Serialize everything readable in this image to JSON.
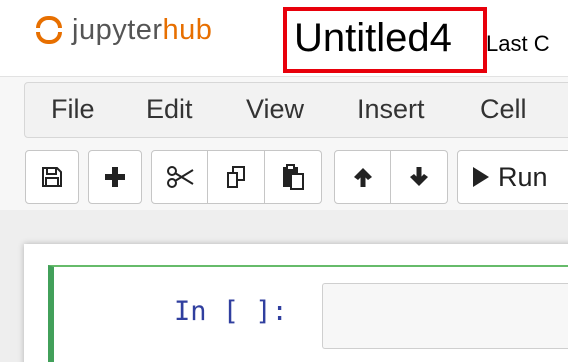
{
  "header": {
    "logo_text_part1": "jupyter",
    "logo_text_part2": "hub",
    "notebook_title": "Untitled4",
    "last_saved_fragment": "Last C"
  },
  "menu": {
    "items": [
      "File",
      "Edit",
      "View",
      "Insert",
      "Cell"
    ]
  },
  "toolbar": {
    "run_label": "Run",
    "icons": [
      "save-icon",
      "plus-icon",
      "cut-icon",
      "copy-icon",
      "paste-icon",
      "arrow-up-icon",
      "arrow-down-icon",
      "run-icon"
    ]
  },
  "cell": {
    "prompt": "In [ ]:",
    "input_value": ""
  },
  "colors": {
    "brand_orange": "#e76f00",
    "highlight_red": "#e8000b",
    "cell_edit_green": "#42a05a",
    "prompt_blue": "#303f9f"
  }
}
